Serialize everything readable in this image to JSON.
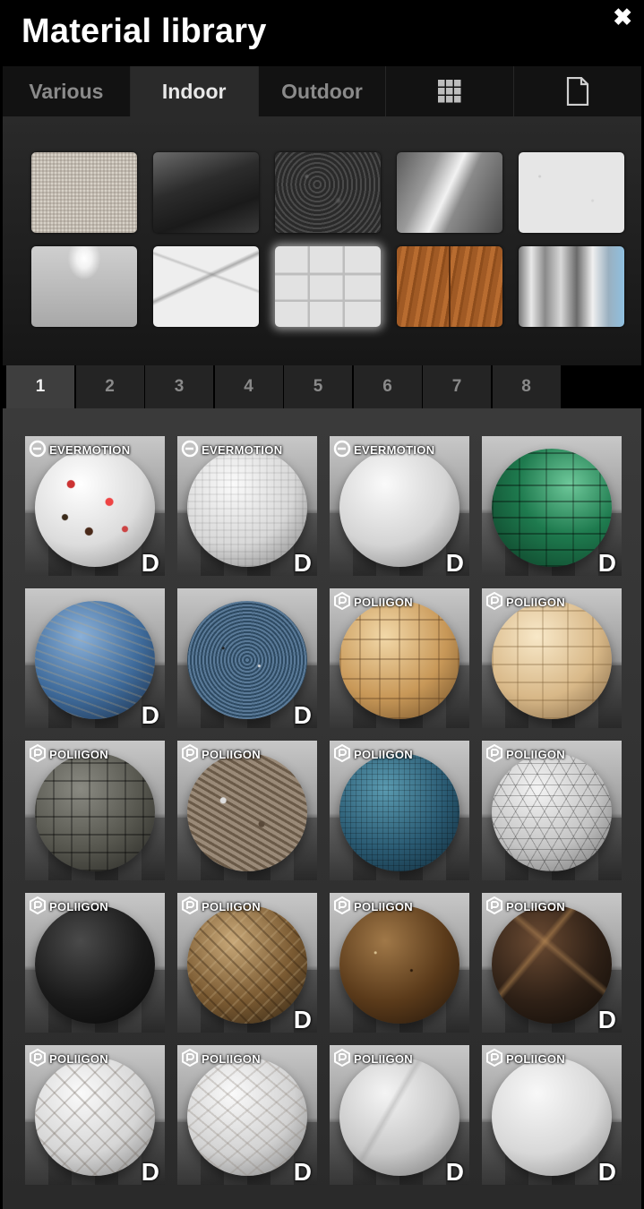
{
  "title": "Material library",
  "close_icon": "close-icon",
  "tabs": [
    {
      "label": "Various",
      "active": false
    },
    {
      "label": "Indoor",
      "active": true
    },
    {
      "label": "Outdoor",
      "active": false
    },
    {
      "label": "",
      "icon": "grid-icon",
      "active": false
    },
    {
      "label": "",
      "icon": "document-icon",
      "active": false
    }
  ],
  "swatches": [
    {
      "name": "fabric"
    },
    {
      "name": "dark-glass"
    },
    {
      "name": "leather"
    },
    {
      "name": "brushed-metal"
    },
    {
      "name": "plaster"
    },
    {
      "name": "glossy-white"
    },
    {
      "name": "marble"
    },
    {
      "name": "tiles",
      "selected": true
    },
    {
      "name": "wood-parquet"
    },
    {
      "name": "chrome"
    }
  ],
  "pages": [
    "1",
    "2",
    "3",
    "4",
    "5",
    "6",
    "7",
    "8"
  ],
  "active_page": "1",
  "materials": [
    {
      "brand": "EVERMOTION",
      "d": "D",
      "material": "terrazzo"
    },
    {
      "brand": "EVERMOTION",
      "d": "D",
      "material": "white-mosaic"
    },
    {
      "brand": "EVERMOTION",
      "d": "D",
      "material": "white-marble"
    },
    {
      "brand": "",
      "d": "D",
      "material": "green-tiles"
    },
    {
      "brand": "",
      "d": "D",
      "material": "blue-granite"
    },
    {
      "brand": "",
      "d": "D",
      "material": "blue-speckled"
    },
    {
      "brand": "POLIIGON",
      "d": "",
      "material": "beige-tiles"
    },
    {
      "brand": "POLIIGON",
      "d": "",
      "material": "cream-tiles"
    },
    {
      "brand": "POLIIGON",
      "d": "",
      "material": "grey-tiles"
    },
    {
      "brand": "POLIIGON",
      "d": "",
      "material": "stone-pebbles"
    },
    {
      "brand": "POLIIGON",
      "d": "",
      "material": "teal-mosaic"
    },
    {
      "brand": "POLIIGON",
      "d": "",
      "material": "white-triangles"
    },
    {
      "brand": "POLIIGON",
      "d": "",
      "material": "black-rubber"
    },
    {
      "brand": "POLIIGON",
      "d": "D",
      "material": "brown-herringbone"
    },
    {
      "brand": "POLIIGON",
      "d": "",
      "material": "brown-granite"
    },
    {
      "brand": "POLIIGON",
      "d": "D",
      "material": "dark-marble"
    },
    {
      "brand": "POLIIGON",
      "d": "D",
      "material": "white-chevron"
    },
    {
      "brand": "POLIIGON",
      "d": "D",
      "material": "white-herringbone"
    },
    {
      "brand": "POLIIGON",
      "d": "D",
      "material": "grey-marble"
    },
    {
      "brand": "POLIIGON",
      "d": "D",
      "material": "white-stone"
    }
  ]
}
